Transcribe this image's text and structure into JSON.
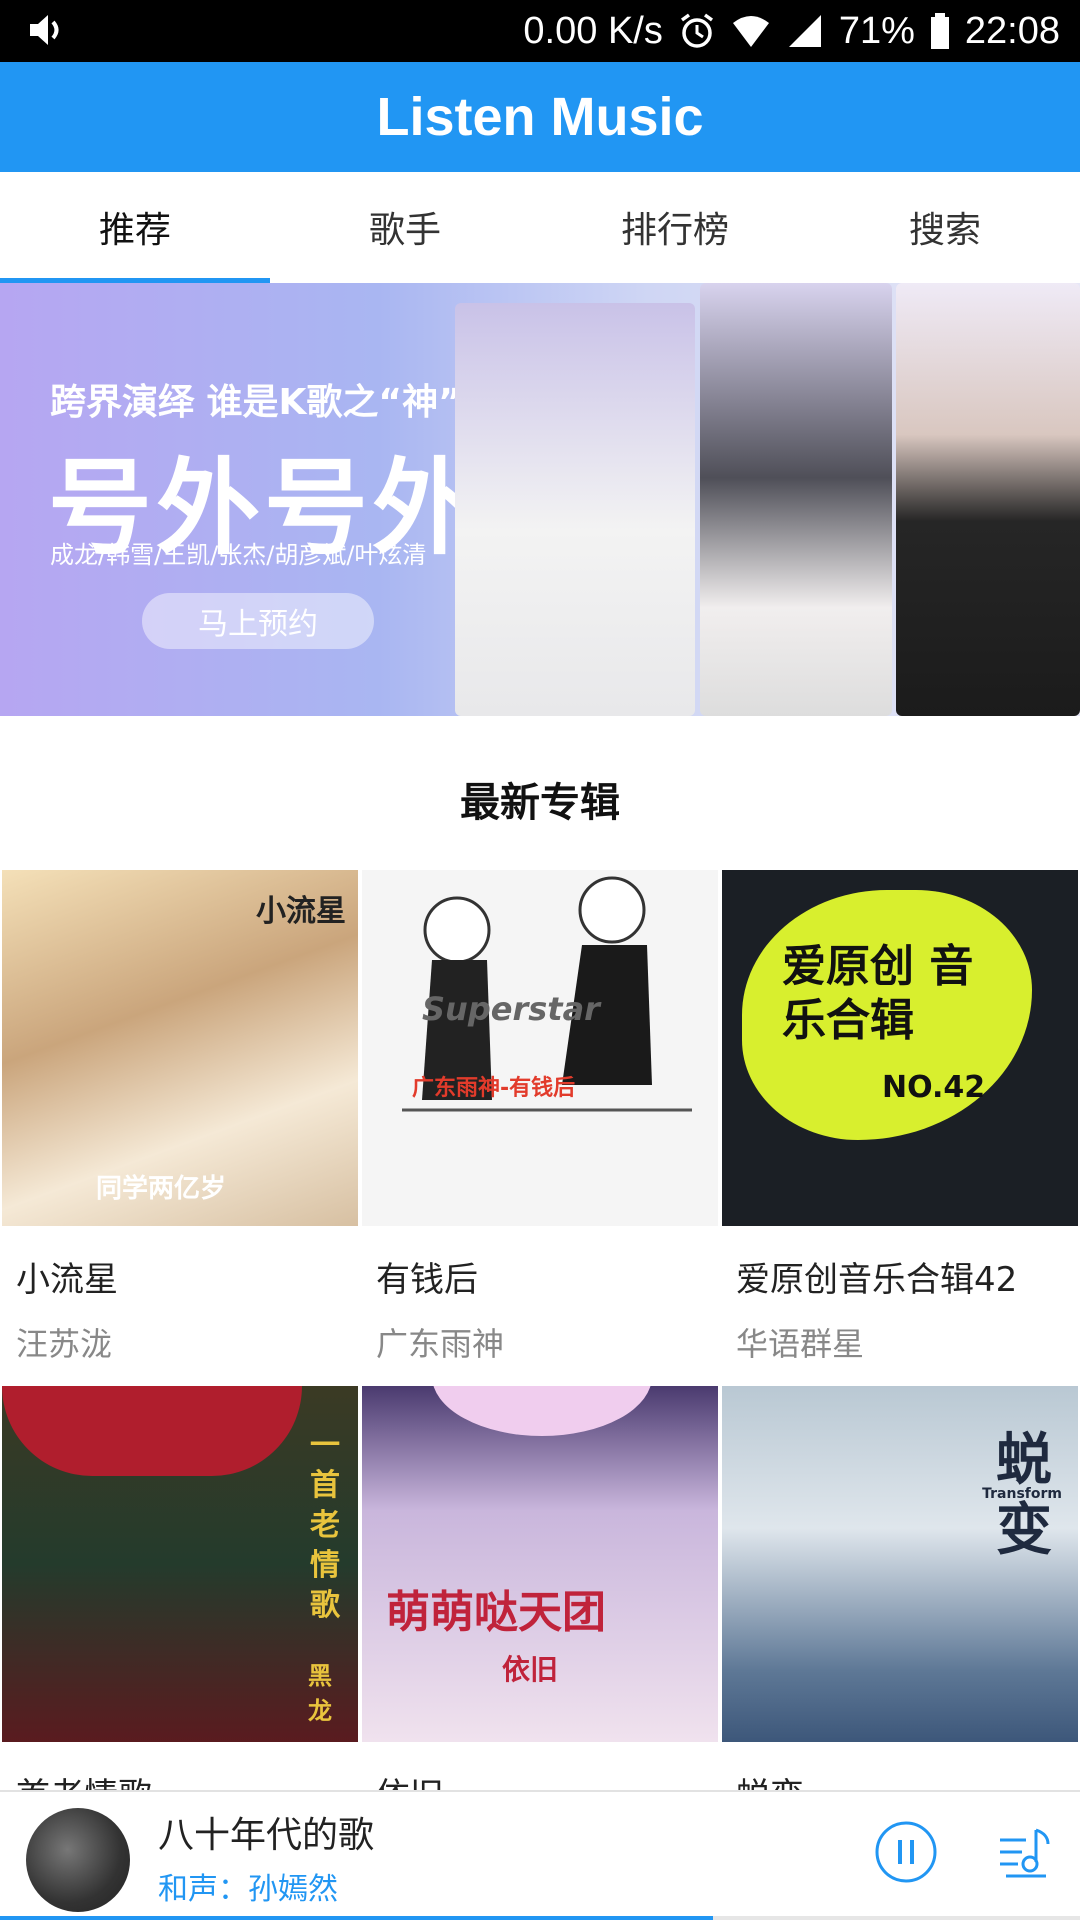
{
  "status_bar": {
    "speed": "0.00 K/s",
    "battery": "71%",
    "time": "22:08"
  },
  "app": {
    "title": "Listen Music"
  },
  "tabs": [
    {
      "label": "推荐",
      "active": true
    },
    {
      "label": "歌手",
      "active": false
    },
    {
      "label": "排行榜",
      "active": false
    },
    {
      "label": "搜索",
      "active": false
    }
  ],
  "banner": {
    "headline": "跨界演绎  谁是K歌之“神”",
    "big_text": "号外号外",
    "names": "成龙/韩雪/王凯/张杰/胡彦斌/叶炫清",
    "cta": "马上预约"
  },
  "section": {
    "title": "最新专辑"
  },
  "albums": [
    {
      "title": "小流星",
      "artist": "汪苏泷",
      "cover_text": "同学两亿岁",
      "cover_tag": "小流星"
    },
    {
      "title": "有钱后",
      "artist": "广东雨神",
      "cover_text": "广东雨神-有钱后",
      "cover_tag": "Superstar"
    },
    {
      "title": "爱原创音乐合辑42",
      "artist": "华语群星",
      "cover_text": "爱原创 音乐合辑",
      "cover_tag": "NO.42"
    },
    {
      "title": "首老情歌",
      "artist": "",
      "cover_text": "一首老情歌",
      "cover_tag": "黑龙"
    },
    {
      "title": "依旧",
      "artist": "",
      "cover_text": "萌萌哒天团",
      "cover_tag": "依旧"
    },
    {
      "title": "蜕变",
      "artist": "",
      "cover_text": "蜕变",
      "cover_tag": "Transform"
    }
  ],
  "player": {
    "song": "八十年代的歌",
    "singer": "和声：孙嫣然",
    "progress_fraction": 0.66
  },
  "colors": {
    "primary": "#2196f3",
    "status_bar": "#000000"
  }
}
